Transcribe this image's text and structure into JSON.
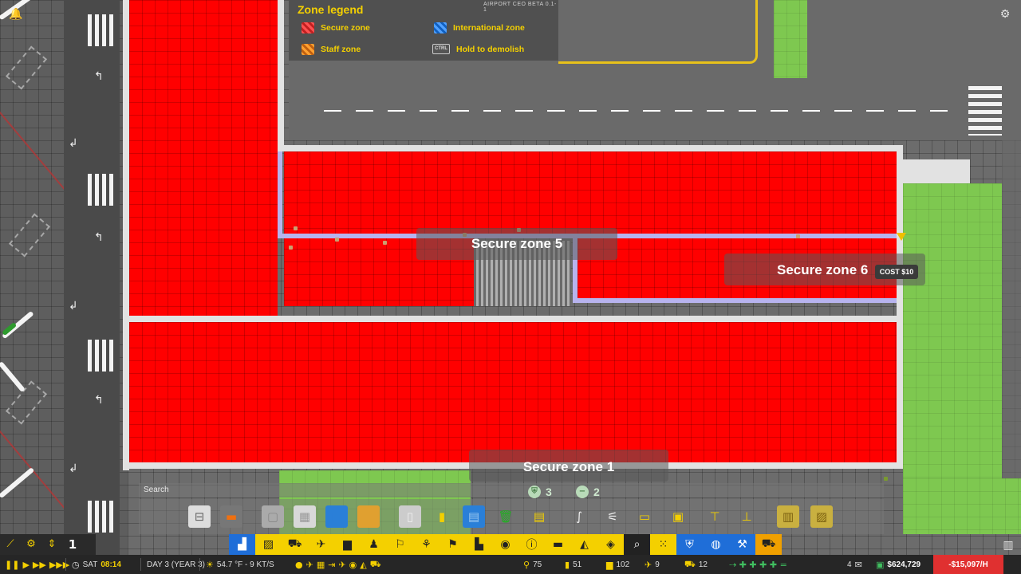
{
  "legend": {
    "title": "Zone legend",
    "version": "AIRPORT CEO BETA 0.1-1",
    "items": [
      {
        "label": "Secure zone",
        "icon": "secure-zone-swatch"
      },
      {
        "label": "International zone",
        "icon": "international-zone-swatch"
      },
      {
        "label": "Staff zone",
        "icon": "staff-zone-swatch"
      },
      {
        "label": "Hold to demolish",
        "key": "CTRL"
      }
    ]
  },
  "zones": {
    "zone5": "Secure zone 5",
    "zone6": "Secure zone 6",
    "zone1": "Secure zone 1",
    "cost": "COST $10"
  },
  "colors": {
    "secure_zone": "#ff0000",
    "grass": "#7ec850",
    "accent_yellow": "#f4d000",
    "accent_blue": "#1f6ed8",
    "negative_rate": "#e03030"
  },
  "build_panel": {
    "search_placeholder": "Search",
    "badge_shield_count": "3",
    "badge_minus_count": "2",
    "items": [
      "desk-icon",
      "checkin-icon",
      "wall-grey-icon",
      "window-icon",
      "tile-blue-icon",
      "tile-orange-icon",
      "door-icon",
      "bin-yellow-icon",
      "floor-blue-icon",
      "trash-green-icon",
      "sign-icon",
      "conveyor-icon",
      "escalator-icon",
      "stairs-icon",
      "bench-icon",
      "info-board-icon",
      "lamp-icon",
      "sign-yellow-icon",
      "map-board-icon",
      "map-board2-icon"
    ]
  },
  "toolbar": {
    "left": {
      "speed_level": "1"
    },
    "categories": [
      "structure",
      "zone",
      "vehicle",
      "aircraft",
      "bus",
      "passenger",
      "security",
      "staff",
      "baggage",
      "shop",
      "food",
      "info",
      "runway",
      "fuel",
      "stack",
      "search",
      "grid",
      "shield",
      "globe",
      "tools",
      "truck"
    ]
  },
  "status": {
    "day": "SAT",
    "time": "08:14",
    "date": "DAY 3 (YEAR 3)",
    "weather": "54.7 °F - 9 KT/S",
    "passengers": "75",
    "staff": "51",
    "buses": "102",
    "flights": "9",
    "vehicles": "12",
    "messages": "4",
    "money": "$624,729",
    "rate": "-$15,097/H"
  }
}
